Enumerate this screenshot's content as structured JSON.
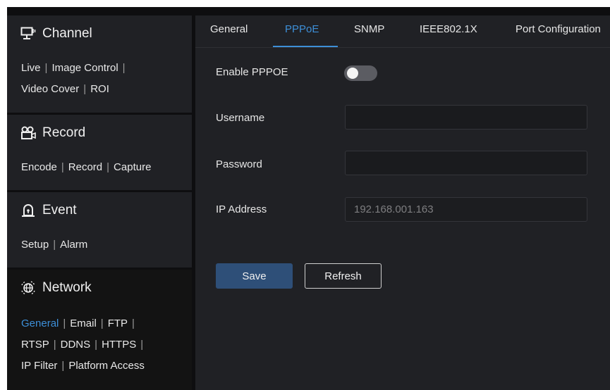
{
  "sidebar": {
    "channel": {
      "title": "Channel",
      "icon": "monitor-icon",
      "links": [
        "Live",
        "Image Control",
        "Video Cover",
        "ROI"
      ]
    },
    "record": {
      "title": "Record",
      "icon": "camera-icon",
      "links": [
        "Encode",
        "Record",
        "Capture"
      ]
    },
    "event": {
      "title": "Event",
      "icon": "alarm-icon",
      "links": [
        "Setup",
        "Alarm"
      ]
    },
    "network": {
      "title": "Network",
      "icon": "globe-icon",
      "links": [
        "General",
        "Email",
        "FTP",
        "RTSP",
        "DDNS",
        "HTTPS",
        "IP Filter",
        "Platform Access"
      ],
      "active_link": "General"
    },
    "separator": "|"
  },
  "tabs": [
    "General",
    "PPPoE",
    "SNMP",
    "IEEE802.1X",
    "Port Configuration"
  ],
  "active_tab": "PPPoE",
  "form": {
    "enable_label": "Enable PPPOE",
    "enable_state": false,
    "username_label": "Username",
    "username_value": "",
    "password_label": "Password",
    "password_value": "",
    "ip_label": "IP Address",
    "ip_value": "192.168.001.163"
  },
  "buttons": {
    "save": "Save",
    "refresh": "Refresh"
  },
  "colors": {
    "accent": "#3d8fd8",
    "save_button": "#2e4f78",
    "panel": "#202125"
  }
}
